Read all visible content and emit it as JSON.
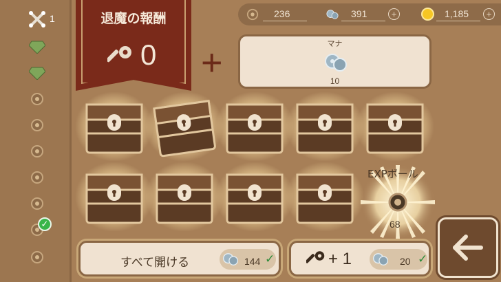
{
  "sidebar": {
    "bones_count": "1",
    "items": [
      "bones-icon",
      "gem-icon",
      "gem-icon",
      "ore-icon",
      "ore-icon",
      "ore-icon",
      "ore-icon",
      "ore-icon",
      "ore-icon",
      "ore-icon"
    ],
    "checked_index": 8
  },
  "banner": {
    "title": "退魔の報酬",
    "key_count": "0"
  },
  "currency": {
    "ore": "236",
    "mana": "391",
    "gold": "1,185"
  },
  "reward": {
    "label": "マナ",
    "value": "10"
  },
  "exp_ball": {
    "label": "EXPボール",
    "value": "68"
  },
  "buttons": {
    "open_all_label": "すべて開ける",
    "open_all_cost": "144",
    "key_label": "+ 1",
    "key_cost": "20"
  },
  "colors": {
    "banner": "#7a2a1a",
    "panel": "#f0e2d1",
    "background": "#a77f57",
    "accent_check": "#3ab54a"
  }
}
